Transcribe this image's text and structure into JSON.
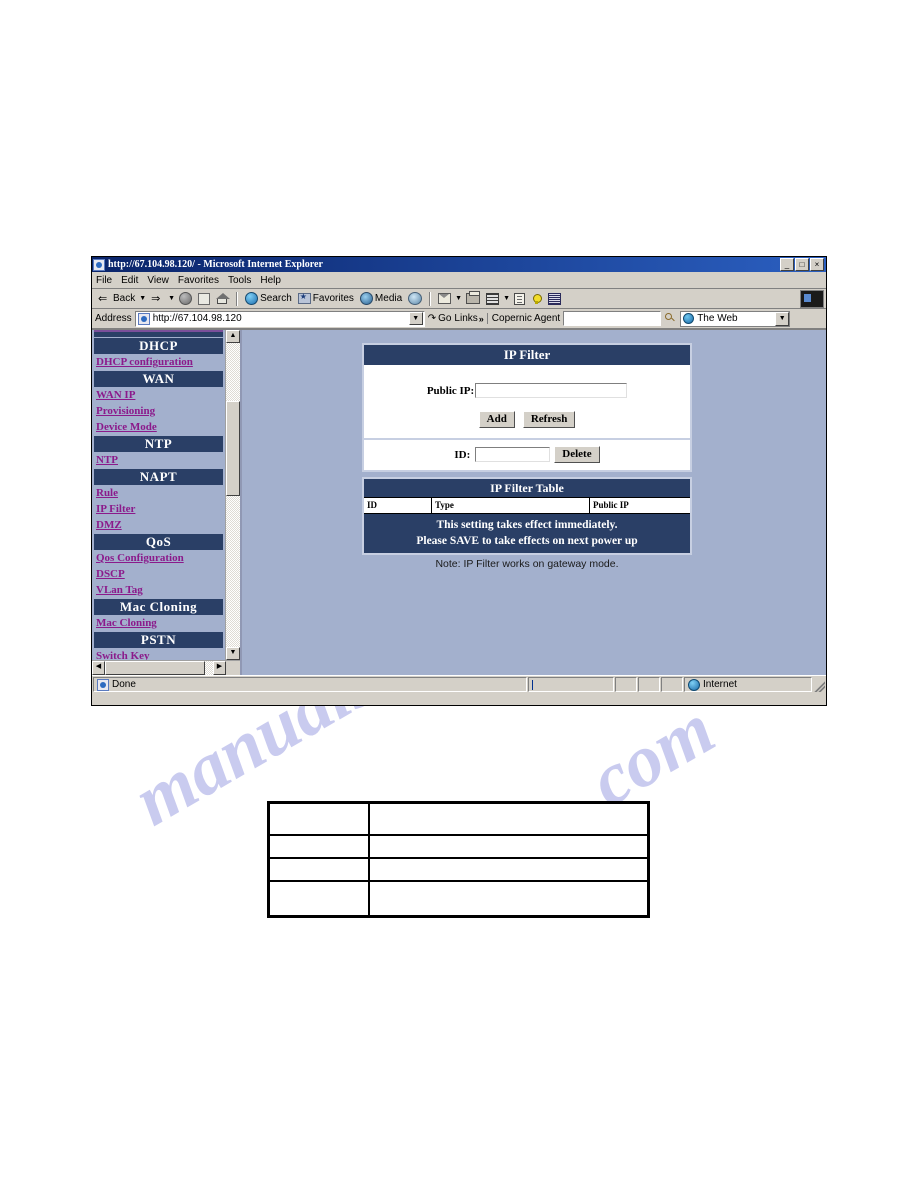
{
  "browser": {
    "title": "http://67.104.98.120/ - Microsoft Internet Explorer",
    "window_buttons": {
      "minimize": "_",
      "maximize": "□",
      "close": "×"
    },
    "menus": [
      "File",
      "Edit",
      "View",
      "Favorites",
      "Tools",
      "Help"
    ],
    "toolbar": {
      "back": "Back",
      "forward": "",
      "stop": "",
      "refresh": "",
      "home": "",
      "search": "Search",
      "favorites": "Favorites",
      "media": "Media",
      "history": "",
      "mail": "",
      "print": "",
      "edit": "",
      "discuss": "",
      "messenger": "",
      "research": ""
    },
    "address": {
      "label": "Address",
      "url": "http://67.104.98.120",
      "go": "Go",
      "links": "Links",
      "chevron": "»"
    },
    "copernic": {
      "label": "Copernic Agent",
      "query": "",
      "scope": "The Web"
    },
    "statusbar": {
      "message": "Done",
      "zone": "Internet"
    }
  },
  "sidebar": {
    "groups": [
      {
        "header": "DHCP",
        "links": [
          "DHCP configuration"
        ]
      },
      {
        "header": "WAN",
        "links": [
          "WAN IP",
          "Provisioning",
          "Device Mode"
        ]
      },
      {
        "header": "NTP",
        "links": [
          "NTP"
        ]
      },
      {
        "header": "NAPT",
        "links": [
          "Rule",
          "IP Filter",
          "DMZ"
        ]
      },
      {
        "header": "QoS",
        "links": [
          "Qos Configuration",
          "DSCP",
          "VLan Tag"
        ]
      },
      {
        "header": "Mac Cloning",
        "links": [
          "Mac Cloning"
        ]
      },
      {
        "header": "PSTN",
        "links": [
          "Switch Key"
        ]
      }
    ]
  },
  "main": {
    "panel_title": "IP Filter",
    "public_ip_label": "Public IP:",
    "public_ip_value": "",
    "add_button": "Add",
    "refresh_button": "Refresh",
    "id_label": "ID:",
    "id_value": "",
    "delete_button": "Delete",
    "table": {
      "title": "IP Filter Table",
      "columns": [
        "ID",
        "Type",
        "Public IP"
      ],
      "rows": [],
      "notice_line1": "This setting takes effect immediately.",
      "notice_line2": "Please SAVE to take effects on next power up"
    },
    "gateway_note": "Note: IP Filter works on gateway mode."
  },
  "lower_table": {
    "rows": [
      {
        "col1": "",
        "col2": ""
      },
      {
        "col1": "",
        "col2": ""
      },
      {
        "col1": "",
        "col2": ""
      },
      {
        "col1": "",
        "col2": ""
      }
    ]
  },
  "watermark": {
    "part_a": "manualslib",
    "part_b": ".com"
  },
  "colors": {
    "navy": "#2a3f66",
    "content_bg": "#a3b0cd",
    "link": "#8b1a8b",
    "chrome": "#d4d0c8",
    "title_gradient_start": "#0a246a"
  }
}
